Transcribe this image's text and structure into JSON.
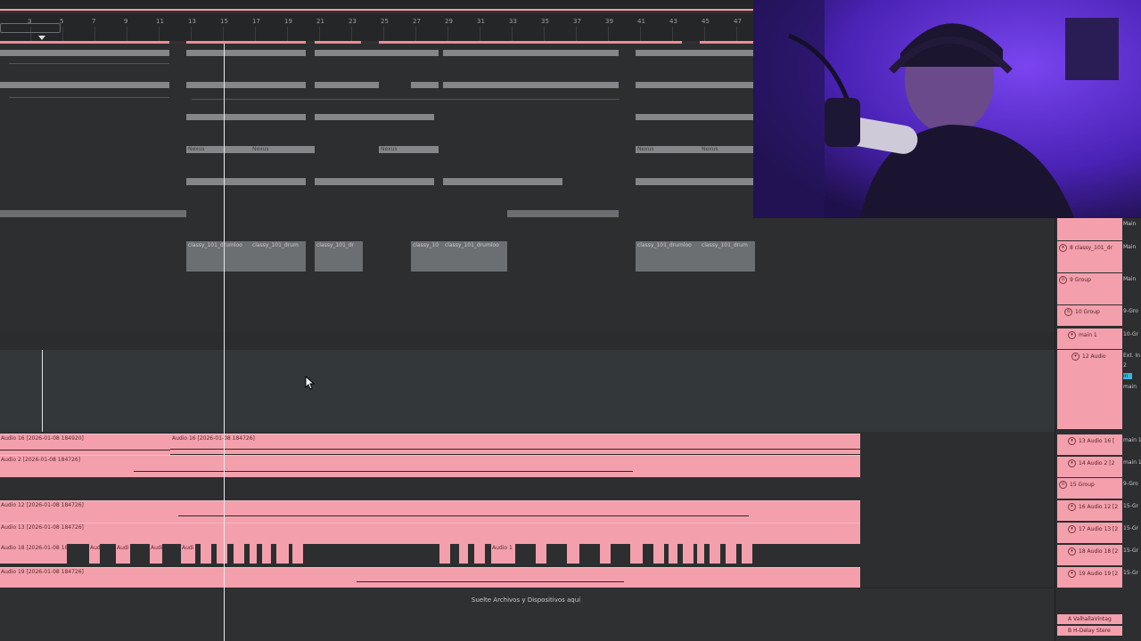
{
  "ruler": {
    "bars": [
      "3",
      "5",
      "7",
      "9",
      "11",
      "13",
      "15",
      "17",
      "19",
      "21",
      "23",
      "25",
      "27",
      "29",
      "31",
      "33",
      "35",
      "37",
      "39",
      "41",
      "43",
      "45",
      "47"
    ]
  },
  "arrangement": {
    "gray_clips": [
      {
        "label": "Nexus"
      },
      {
        "label": "Nexus"
      },
      {
        "label": "Nexus"
      },
      {
        "label": "Nexus"
      },
      {
        "label": "Nexus"
      }
    ],
    "drum_clips": [
      {
        "label": "classy_101_drumloo"
      },
      {
        "label": "classy_101_drum"
      },
      {
        "label": "classy_101_dr"
      },
      {
        "label": "classy_10"
      },
      {
        "label": "classy_101_drumloo"
      },
      {
        "label": "classy_101_drumloo"
      },
      {
        "label": "classy_101_drum"
      }
    ],
    "audio_clips": {
      "audio16_a": "Audio 16 [2026-01-08 184920]",
      "audio16_b": "Audio 16 [2026-01-08 184726]",
      "audio2": "Audio 2 [2026-01-08 184726]",
      "audio12": "Audio 12 [2026-01-08 184726]",
      "audio13": "Audio 13 [2026-01-08 184726]",
      "audio18": "Audio 18 [2026-01-08 18",
      "audio19": "Audio 19 [2026-01-08 184726]",
      "chop_label": "Audi",
      "chop_label2": "Audio 1"
    },
    "drop_text": "Suelte Archivos y Dispositivos aquí"
  },
  "mixer": {
    "tracks": [
      {
        "name": "",
        "route": "Main"
      },
      {
        "name": "8 classy_101_dr",
        "route": "Main"
      },
      {
        "name": "9 Group",
        "route": "Main"
      },
      {
        "name": "10 Group",
        "route": "9-Gro"
      },
      {
        "name": "main 1",
        "route": "10-Gr"
      },
      {
        "name": "12 Audio",
        "route": "Ext. In"
      },
      {
        "name": "13 Audio 16 [",
        "route": "main 1"
      },
      {
        "name": "14 Audio 2 [2",
        "route": "main 1"
      },
      {
        "name": "15 Group",
        "route": "9-Gro"
      },
      {
        "name": "16 Audio 12 [2",
        "route": "15-Gr"
      },
      {
        "name": "17 Audio 13 [2",
        "route": "15-Gr"
      },
      {
        "name": "18 Audio 18 [2",
        "route": "15-Gr"
      },
      {
        "name": "19 Audio 19 [2",
        "route": "15-Gr"
      }
    ],
    "track12_extra": [
      "2",
      "In",
      "main"
    ],
    "returns": [
      {
        "name": "A ValhallaVintag"
      },
      {
        "name": "B H-Delay Stere"
      }
    ]
  },
  "colors": {
    "clip_pink": "#f3a0ac",
    "clip_gray": "#8e9194",
    "background": "#2e3032",
    "webcam_light": "#5b2bd6"
  }
}
